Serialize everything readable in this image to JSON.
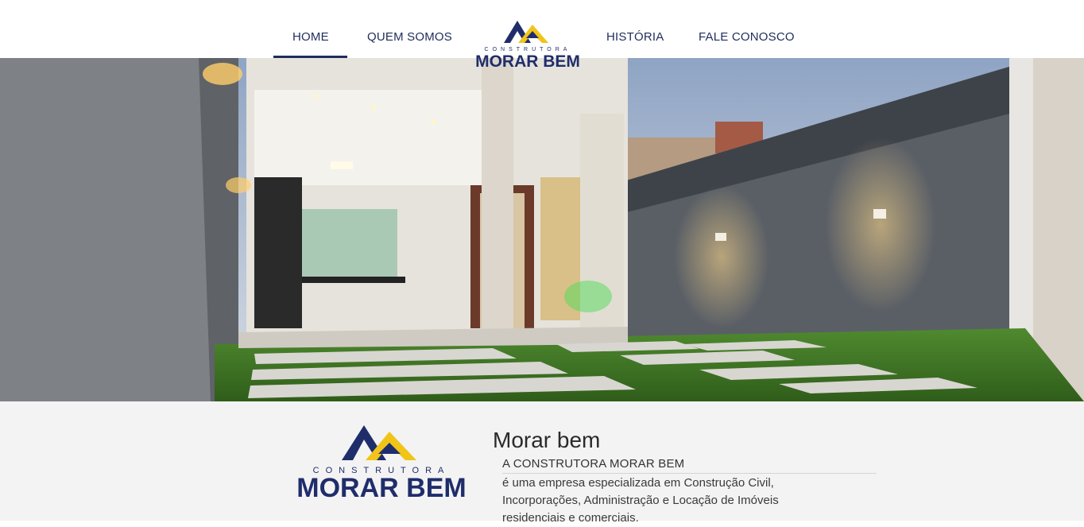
{
  "nav": {
    "items": [
      {
        "label": "HOME",
        "active": true
      },
      {
        "label": "QUEM SOMOS",
        "active": false
      },
      {
        "label": "HISTÓRIA",
        "active": false
      },
      {
        "label": "FALE CONOSCO",
        "active": false
      }
    ]
  },
  "brand": {
    "word_top": "CONSTRUTORA",
    "word_main": "MORAR BEM",
    "colors": {
      "navy": "#1f2d6b",
      "yellow": "#f0c419"
    }
  },
  "about": {
    "title": "Morar bem",
    "subtitle": "A CONSTRUTORA MORAR BEM",
    "body": "é uma empresa especializada em Construção Civil, Incorporações, Administração e Locação de Imóveis residenciais e comerciais."
  }
}
